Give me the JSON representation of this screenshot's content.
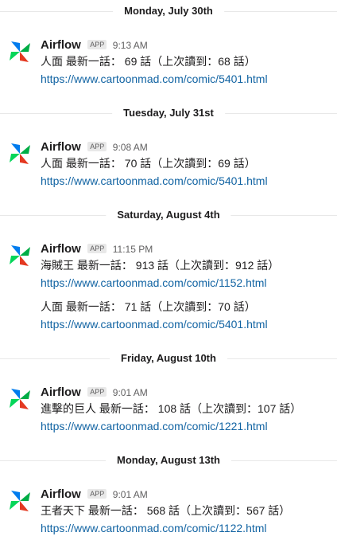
{
  "sender": "Airflow",
  "badge": "APP",
  "icons": {
    "avatar": "airflow-pinwheel-icon"
  },
  "colors": {
    "link": "#1264a3",
    "pinwheel_blue": "#017cee",
    "pinwheel_green": "#00ad46",
    "pinwheel_red": "#e43921",
    "pinwheel_teal": "#04d659"
  },
  "days": [
    {
      "label": "Monday, July 30th",
      "message": {
        "time": "9:13 AM",
        "entries": [
          {
            "text": "人面 最新一話： 69 話（上次讀到：68 話）",
            "link": "https://www.cartoonmad.com/comic/5401.html"
          }
        ]
      }
    },
    {
      "label": "Tuesday, July 31st",
      "message": {
        "time": "9:08 AM",
        "entries": [
          {
            "text": "人面 最新一話： 70 話（上次讀到：69 話）",
            "link": "https://www.cartoonmad.com/comic/5401.html"
          }
        ]
      }
    },
    {
      "label": "Saturday, August 4th",
      "message": {
        "time": "11:15 PM",
        "entries": [
          {
            "text": "海賊王 最新一話： 913 話（上次讀到：912 話）",
            "link": "https://www.cartoonmad.com/comic/1152.html"
          },
          {
            "text": "人面 最新一話： 71 話（上次讀到：70 話）",
            "link": "https://www.cartoonmad.com/comic/5401.html"
          }
        ]
      }
    },
    {
      "label": "Friday, August 10th",
      "message": {
        "time": "9:01 AM",
        "entries": [
          {
            "text": "進擊的巨人 最新一話： 108 話（上次讀到：107 話）",
            "link": "https://www.cartoonmad.com/comic/1221.html"
          }
        ]
      }
    },
    {
      "label": "Monday, August 13th",
      "message": {
        "time": "9:01 AM",
        "entries": [
          {
            "text": "王者天下 最新一話： 568 話（上次讀到：567 話）",
            "link": "https://www.cartoonmad.com/comic/1122.html"
          }
        ]
      }
    }
  ]
}
